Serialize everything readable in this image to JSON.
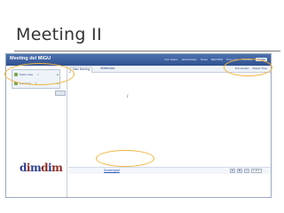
{
  "slide": {
    "title": "Meeting II"
  },
  "app": {
    "name": "Meeting del MIGU",
    "top_links": [
      "Your status:",
      "administrator",
      "Notes",
      "RECORD",
      "Time zone",
      "Pending",
      "Logout"
    ]
  },
  "sidebar": {
    "items": [
      {
        "label": "Pedro Jose",
        "mark": "✓"
      },
      {
        "label": "Francisco",
        "mark": "✓"
      }
    ],
    "logo_text_1": "d",
    "logo_text_2": "i",
    "logo_text_3": "m",
    "logo_text_4": "d",
    "logo_text_5": "i",
    "logo_text_6": "m"
  },
  "main": {
    "tabs": [
      "Main Meeting",
      "Whiteboard"
    ],
    "right_tools": [
      "Full window",
      "Master Time"
    ],
    "cursor": "/",
    "bottom_link": "Scratchpad",
    "bottom_tools": [
      "A",
      "B",
      "I",
      "1 of 1"
    ]
  },
  "colors": {
    "highlight": "#f0b43a",
    "topbar": "#3b5fa0",
    "link": "#2e59b8"
  }
}
